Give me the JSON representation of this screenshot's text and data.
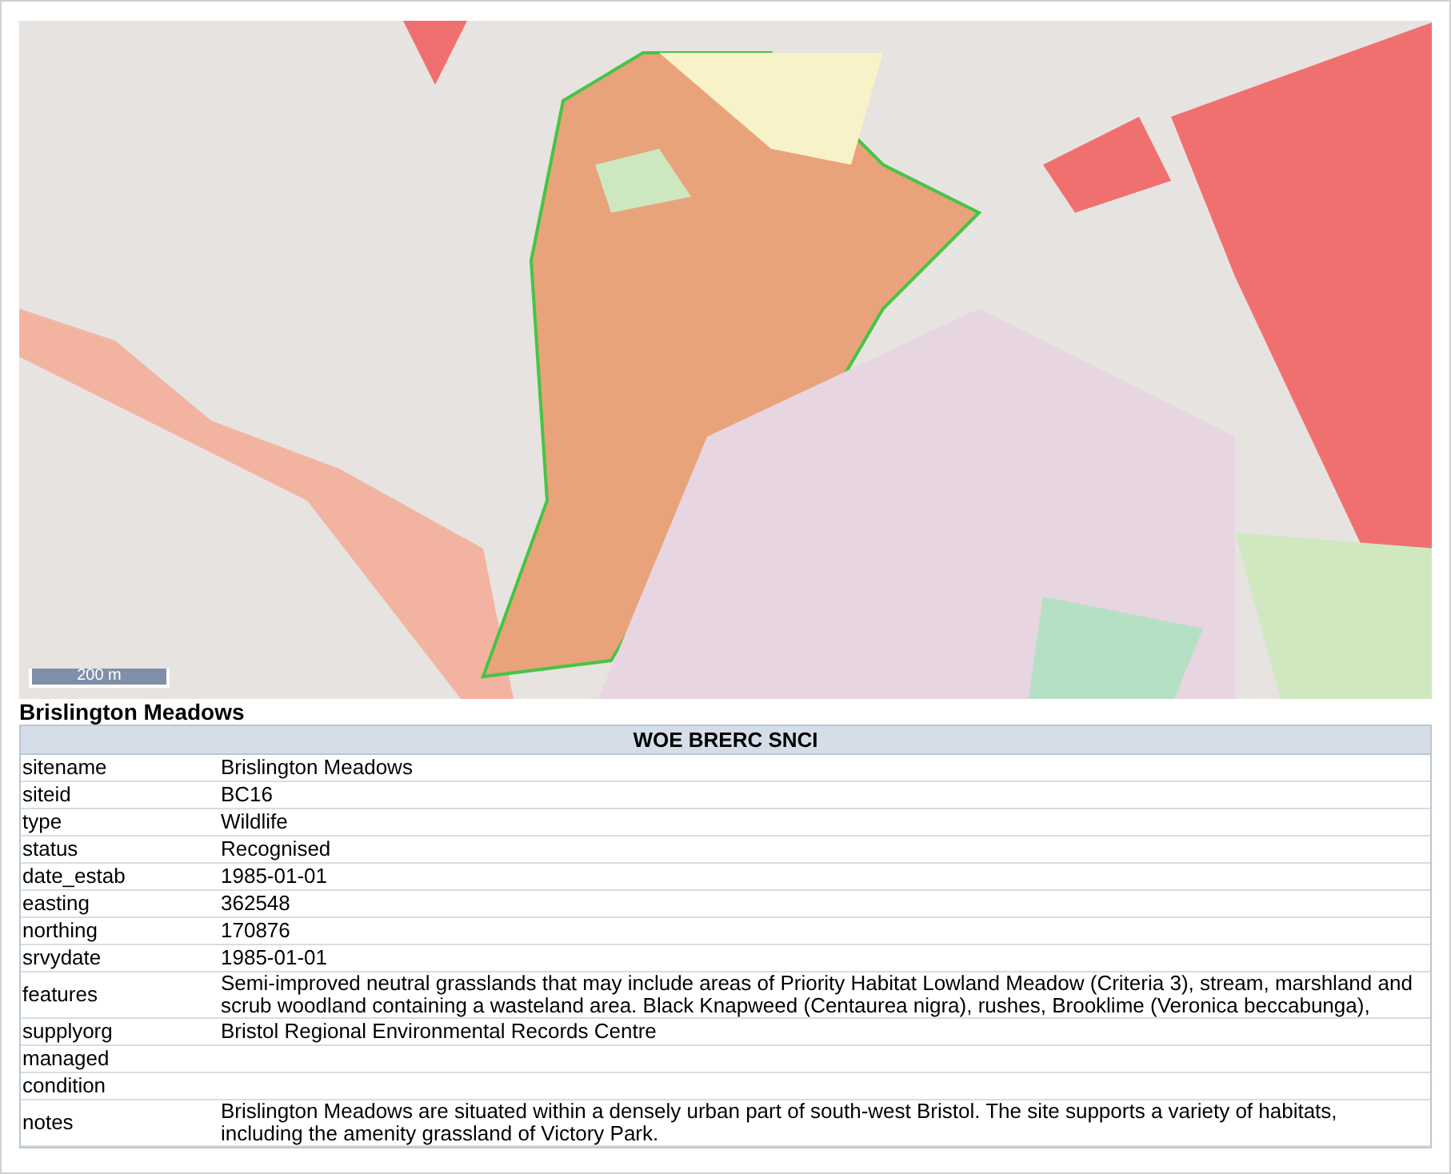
{
  "map": {
    "scale_label": "200 m"
  },
  "site_title": "Brislington Meadows",
  "table": {
    "heading": "WOE BRERC SNCI",
    "rows": [
      {
        "field": "sitename",
        "value": "Brislington Meadows"
      },
      {
        "field": "siteid",
        "value": "BC16"
      },
      {
        "field": "type",
        "value": "Wildlife"
      },
      {
        "field": "status",
        "value": "Recognised"
      },
      {
        "field": "date_estab",
        "value": "1985-01-01"
      },
      {
        "field": "easting",
        "value": "362548"
      },
      {
        "field": "northing",
        "value": "170876"
      },
      {
        "field": "srvydate",
        "value": "1985-01-01"
      },
      {
        "field": "features",
        "value": "Semi-improved neutral grasslands that may include areas of Priority Habitat Lowland Meadow (Criteria 3), stream, marshland and scrub woodland containing a wasteland area. Black Knapweed (Centaurea nigra), rushes, Brooklime (Veronica beccabunga),"
      },
      {
        "field": "supplyorg",
        "value": "Bristol Regional Environmental Records Centre"
      },
      {
        "field": "managed"
      },
      {
        "field": "condition"
      },
      {
        "field": "notes",
        "value": "Brislington Meadows are situated within a densely urban part of south-west Bristol. The site supports a variety of habitats, including the amenity grassland of Victory Park."
      }
    ]
  }
}
